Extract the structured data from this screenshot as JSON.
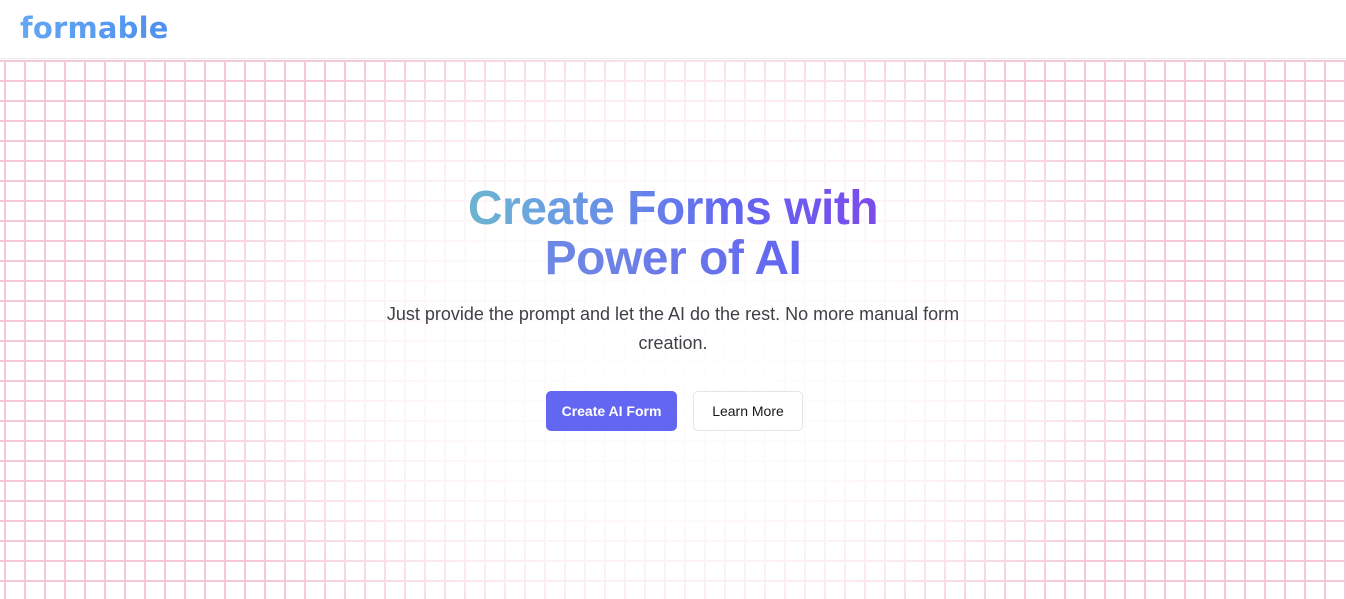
{
  "header": {
    "logo_text": "formable"
  },
  "hero": {
    "headline_line1": "Create Forms with",
    "headline_line2": "Power of AI",
    "subtitle": "Just provide the prompt and let the AI do the rest. No more manual form creation.",
    "primary_button_label": "Create AI Form",
    "secondary_button_label": "Learn More"
  },
  "colors": {
    "accent": "#6366f1",
    "logo": "#5b9cf0",
    "grid_lines": "#f3b9cd"
  }
}
